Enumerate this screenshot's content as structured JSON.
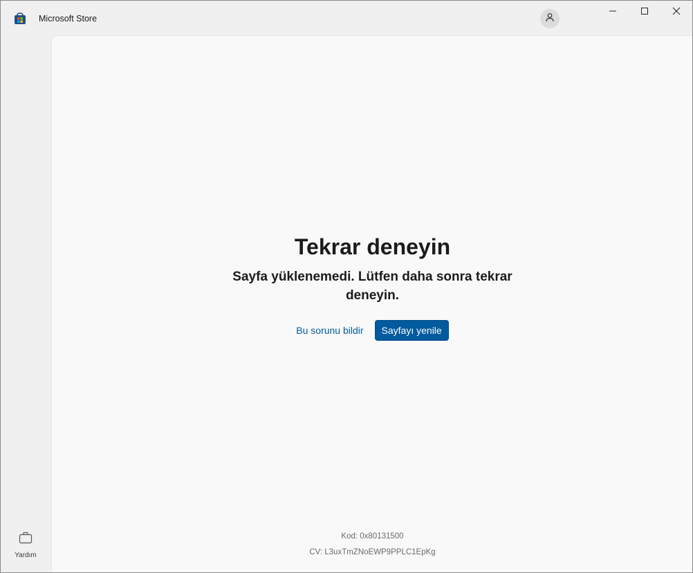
{
  "window": {
    "title": "Microsoft Store"
  },
  "icons": {
    "app": "microsoft-store-icon",
    "account": "person-icon",
    "minimize": "minimize-icon",
    "maximize": "maximize-icon",
    "close": "close-icon",
    "help": "briefcase-icon"
  },
  "sidebar": {
    "help_label": "Yardım"
  },
  "error": {
    "title": "Tekrar deneyin",
    "message": "Sayfa yüklenemedi. Lütfen daha sonra tekrar deneyin.",
    "report_label": "Bu sorunu bildir",
    "refresh_label": "Sayfayı yenile",
    "code": "Kod: 0x80131500",
    "cv": "CV: L3uxTmZNoEWP9PPLC1EpKg"
  },
  "colors": {
    "accent": "#005a9e",
    "background": "#f9f9f9",
    "chrome": "#f0f0f0"
  }
}
